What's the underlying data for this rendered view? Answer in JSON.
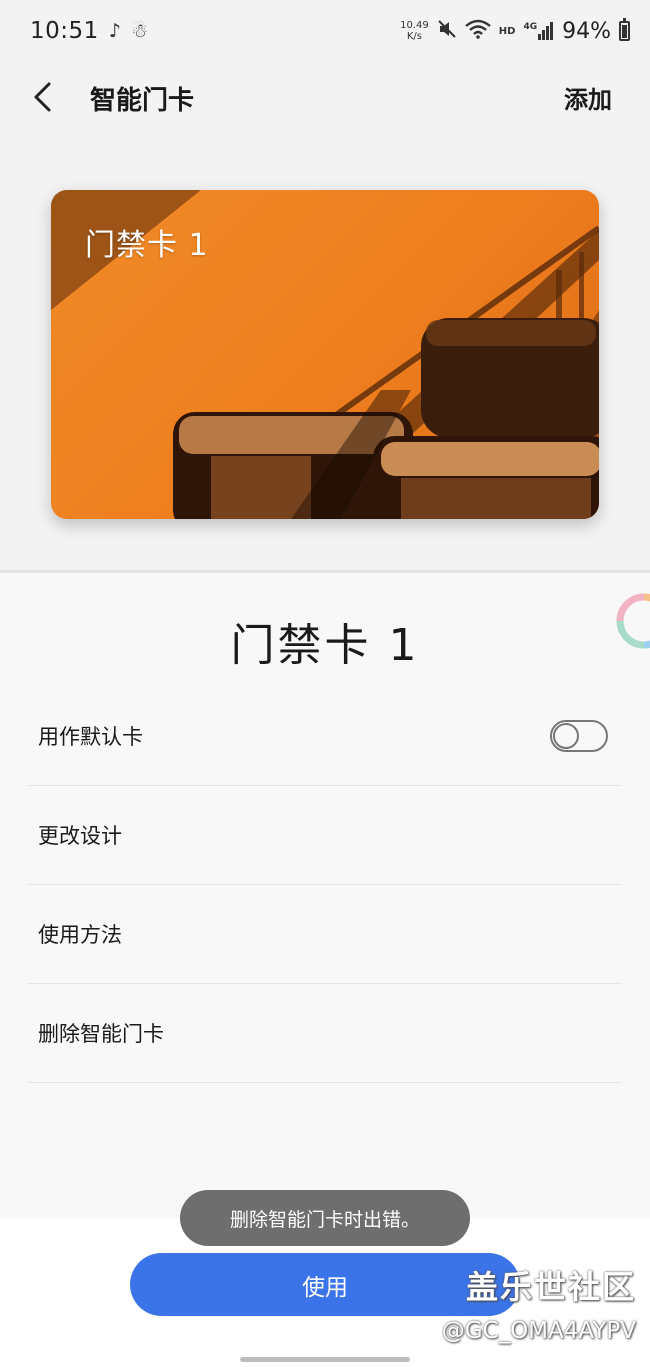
{
  "status_bar": {
    "time": "10:51",
    "app_icons": [
      "tiktok-icon",
      "notification-figure-icon"
    ],
    "net_speed_value": "10.49",
    "net_speed_unit": "K/s",
    "hd_label": "HD",
    "network_label": "4G",
    "battery_percent": "94%",
    "battery_level": 0.94
  },
  "app_bar": {
    "title": "智能门卡",
    "add_label": "添加"
  },
  "card": {
    "name": "门禁卡 1",
    "background_color": "#ee7e1e"
  },
  "sheet": {
    "title": "门禁卡 1",
    "menu": [
      {
        "label": "用作默认卡",
        "has_toggle": true,
        "toggle_on": false
      },
      {
        "label": "更改设计"
      },
      {
        "label": "使用方法"
      },
      {
        "label": "删除智能门卡"
      }
    ]
  },
  "toast": {
    "message": "删除智能门卡时出错。"
  },
  "primary_button": {
    "label": "使用",
    "color": "#3b74e8"
  },
  "watermark": {
    "title": "盖乐世社区",
    "id": "@GC_OMA4AYPV"
  }
}
